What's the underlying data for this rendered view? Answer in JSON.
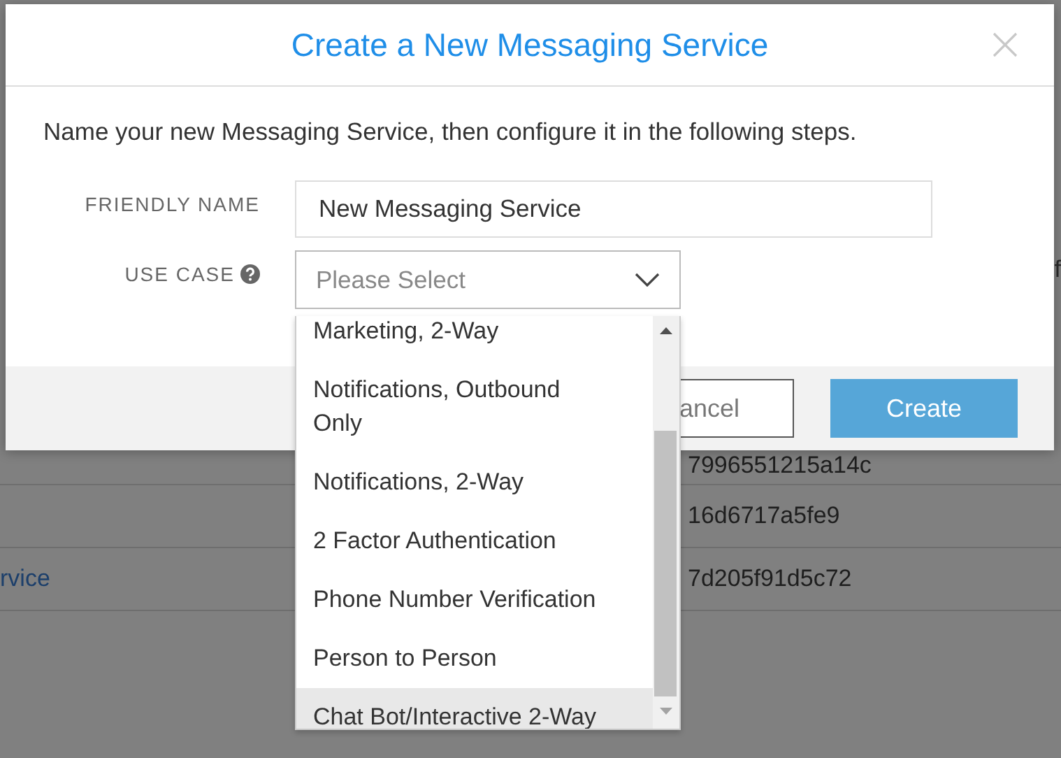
{
  "background": {
    "right_fragments": [
      "f"
    ],
    "rows": [
      {
        "sid": "7996551215a14c"
      },
      {
        "sid": "16d6717a5fe9"
      },
      {
        "name": "rvice",
        "sid": "7d205f91d5c72"
      }
    ]
  },
  "modal": {
    "title": "Create a New Messaging Service",
    "intro": "Name your new Messaging Service, then configure it in the following steps.",
    "friendly_name": {
      "label": "FRIENDLY NAME",
      "value": "New Messaging Service"
    },
    "use_case": {
      "label": "USE CASE",
      "placeholder": "Please Select",
      "expanded": true,
      "options": [
        {
          "label": "Marketing, 2-Way",
          "selected": false
        },
        {
          "label": "Notifications, Outbound Only",
          "selected": false
        },
        {
          "label": "Notifications, 2-Way",
          "selected": false
        },
        {
          "label": "2 Factor Authentication",
          "selected": false
        },
        {
          "label": "Phone Number Verification",
          "selected": false
        },
        {
          "label": "Person to Person",
          "selected": false
        },
        {
          "label": "Chat Bot/Interactive 2-Way",
          "selected": true
        }
      ]
    },
    "buttons": [
      {
        "kind": "secondary",
        "label": "ancel"
      },
      {
        "kind": "primary",
        "label": "Create"
      }
    ]
  }
}
